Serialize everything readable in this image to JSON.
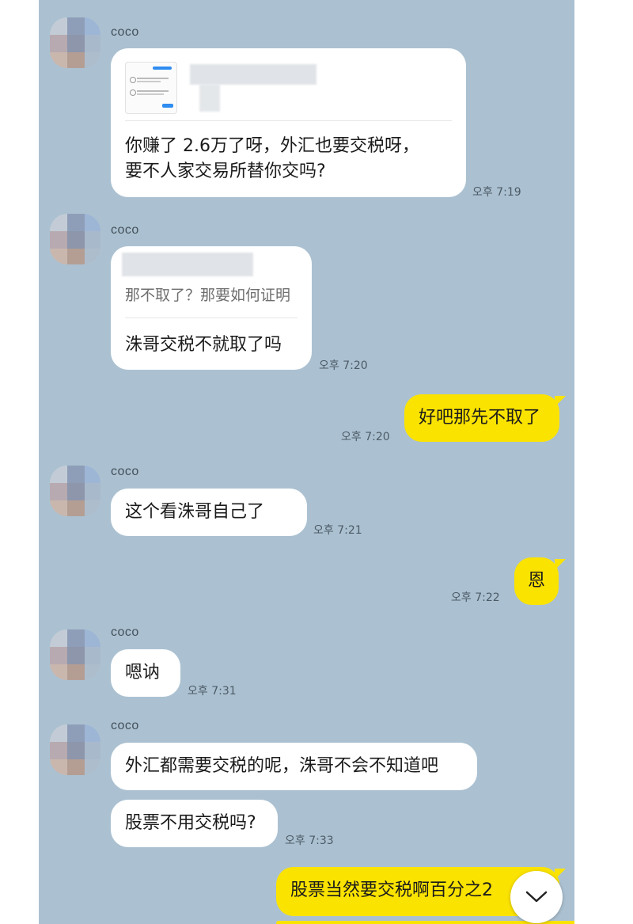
{
  "contact": {
    "name": "coco"
  },
  "messages": {
    "m1": {
      "text_line1": "你赚了 2.6万了呀，外汇也要交税呀，",
      "text_line2": "要不人家交易所替你交吗?",
      "time": "오후 7:19"
    },
    "m2": {
      "quote": "那不取了？那要如何证明",
      "text": "洙哥交税不就取了吗",
      "time": "오후 7:20"
    },
    "m3": {
      "text": "好吧那先不取了",
      "time": "오후 7:20"
    },
    "m4": {
      "text": "这个看洙哥自己了",
      "time": "오후 7:21"
    },
    "m5": {
      "text": "恩",
      "time": "오후 7:22"
    },
    "m6": {
      "text": "嗯讷",
      "time": "오후 7:31"
    },
    "m7": {
      "text": "外汇都需要交税的呢，洙哥不会不知道吧"
    },
    "m8": {
      "text": "股票不用交税吗?",
      "time": "오후 7:33"
    },
    "m9": {
      "text": "股票当然要交税啊百分之2"
    }
  },
  "icons": {
    "scroll_down": "chevron-down-icon",
    "avatar": "blurred-avatar"
  },
  "colors": {
    "chat_background": "#abc1d1",
    "incoming_bubble": "#ffffff",
    "outgoing_bubble": "#fbe300"
  }
}
